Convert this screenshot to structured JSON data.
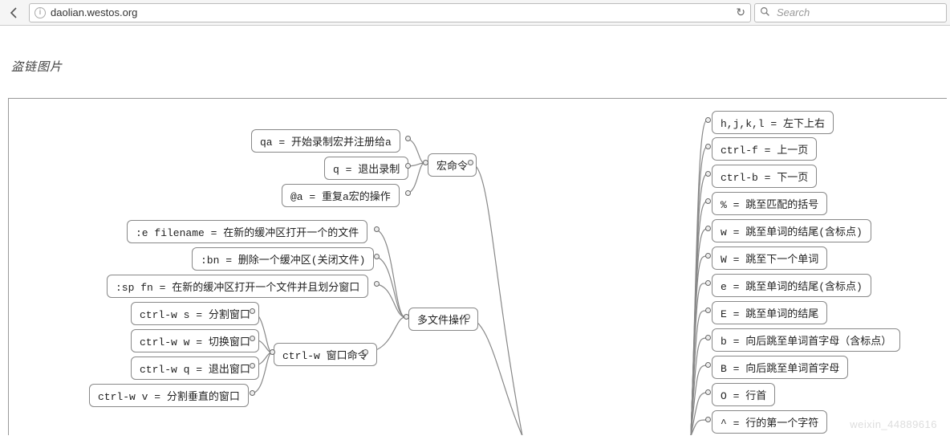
{
  "browser": {
    "url_prefix": "",
    "url_host": "daolian.westos.org",
    "search_placeholder": "Search"
  },
  "page": {
    "caption": "盗链图片",
    "watermark": "weixin_44889616"
  },
  "mindmap": {
    "macro": {
      "title": "宏命令",
      "items": [
        "qa = 开始录制宏并注册给a",
        "q = 退出录制",
        "@a = 重复a宏的操作"
      ]
    },
    "multifile": {
      "title": "多文件操作",
      "items": [
        ":e filename = 在新的缓冲区打开一个的文件",
        ":bn = 删除一个缓冲区(关闭文件)",
        ":sp fn = 在新的缓冲区打开一个文件并且划分窗口"
      ],
      "ctrlw": {
        "title": "ctrl-w 窗口命令",
        "items": [
          "ctrl-w s = 分割窗口",
          "ctrl-w w = 切换窗口",
          "ctrl-w q = 退出窗口",
          "ctrl-w v = 分割垂直的窗口"
        ]
      }
    },
    "motion": {
      "items": [
        "h,j,k,l = 左下上右",
        "ctrl-f = 上一页",
        "ctrl-b = 下一页",
        "% = 跳至匹配的括号",
        "w = 跳至单词的结尾(含标点)",
        "W = 跳至下一个单词",
        "e = 跳至单词的结尾(含标点)",
        "E = 跳至单词的结尾",
        "b = 向后跳至单词首字母（含标点）",
        "B = 向后跳至单词首字母",
        "O = 行首",
        "^ = 行的第一个字符"
      ]
    }
  }
}
